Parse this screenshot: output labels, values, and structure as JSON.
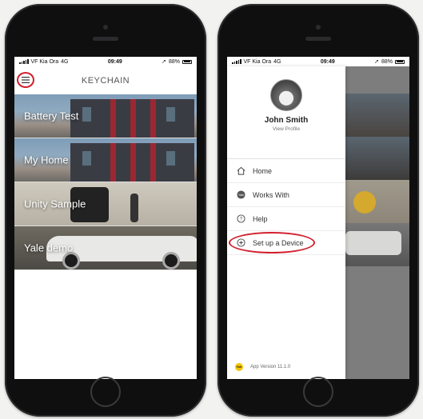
{
  "left_screen": {
    "status": {
      "carrier": "VF Kia Ora",
      "network": "4G",
      "time": "09:49",
      "battery": "88%"
    },
    "header": {
      "title": "KEYCHAIN",
      "menu_icon": "hamburger-icon"
    },
    "tiles": [
      {
        "label": "Battery Test"
      },
      {
        "label": "My Home"
      },
      {
        "label": "Unity Sample"
      },
      {
        "label": "Yale demo"
      }
    ]
  },
  "right_screen": {
    "status": {
      "carrier": "VF Kia Ora",
      "network": "4G",
      "time": "09:49",
      "battery": "88%"
    },
    "profile": {
      "name": "John Smith",
      "link": "View Profile"
    },
    "menu": [
      {
        "label": "Home",
        "icon": "home-icon"
      },
      {
        "label": "Works With",
        "icon": "yale-icon"
      },
      {
        "label": "Help",
        "icon": "help-icon"
      },
      {
        "label": "Set up a Device",
        "icon": "add-circle-icon"
      }
    ],
    "footer": {
      "logo_text": "Yale",
      "version": "App Version 11.1.0"
    }
  },
  "colors": {
    "highlight": "#d21f2e",
    "yale_yellow": "#f4c400"
  }
}
